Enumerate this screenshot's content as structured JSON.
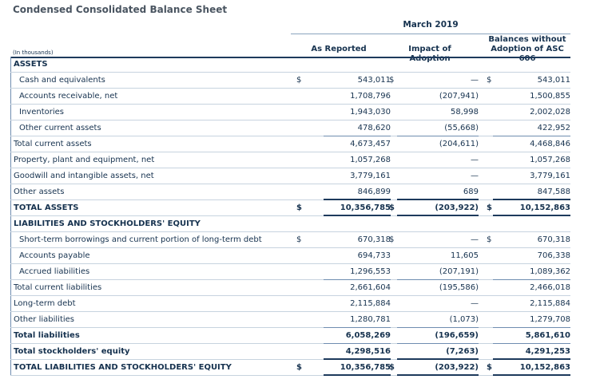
{
  "title": "Condensed Consolidated Balance Sheet",
  "period": "March 2019",
  "units": "(In thousands)",
  "columns": [
    "As Reported",
    "Impact of Adoption",
    "Balances without Adoption of ASC 606"
  ],
  "dollar_sign": "$",
  "rows": [
    {
      "label": "ASSETS",
      "type": "heading",
      "v": [
        "",
        "",
        ""
      ]
    },
    {
      "label": "Cash and equivalents",
      "indent": true,
      "dollar": true,
      "v": [
        "543,011",
        "—",
        "543,011"
      ]
    },
    {
      "label": "Accounts receivable, net",
      "indent": true,
      "v": [
        "1,708,796",
        "(207,941)",
        "1,500,855"
      ]
    },
    {
      "label": "Inventories",
      "indent": true,
      "v": [
        "1,943,030",
        "58,998",
        "2,002,028"
      ]
    },
    {
      "label": "Other current assets",
      "indent": true,
      "v": [
        "478,620",
        "(55,668)",
        "422,952"
      ]
    },
    {
      "label": "Total current assets",
      "v": [
        "4,673,457",
        "(204,611)",
        "4,468,846"
      ]
    },
    {
      "label": "Property, plant and equipment, net",
      "v": [
        "1,057,268",
        "—",
        "1,057,268"
      ]
    },
    {
      "label": "Goodwill and intangible assets, net",
      "v": [
        "3,779,161",
        "—",
        "3,779,161"
      ]
    },
    {
      "label": "Other assets",
      "v": [
        "846,899",
        "689",
        "847,588"
      ]
    },
    {
      "label": "TOTAL ASSETS",
      "type": "bold",
      "dollar": true,
      "v": [
        "10,356,785",
        "(203,922)",
        "10,152,863"
      ]
    },
    {
      "label": "LIABILITIES AND STOCKHOLDERS' EQUITY",
      "type": "heading",
      "v": [
        "",
        "",
        ""
      ]
    },
    {
      "label": "Short-term borrowings and current portion of long-term debt",
      "indent": true,
      "dollar": true,
      "v": [
        "670,318",
        "—",
        "670,318"
      ]
    },
    {
      "label": "Accounts payable",
      "indent": true,
      "v": [
        "694,733",
        "11,605",
        "706,338"
      ]
    },
    {
      "label": "Accrued liabilities",
      "indent": true,
      "v": [
        "1,296,553",
        "(207,191)",
        "1,089,362"
      ]
    },
    {
      "label": "Total current liabilities",
      "v": [
        "2,661,604",
        "(195,586)",
        "2,466,018"
      ]
    },
    {
      "label": "Long-term debt",
      "v": [
        "2,115,884",
        "—",
        "2,115,884"
      ]
    },
    {
      "label": "Other liabilities",
      "v": [
        "1,280,781",
        "(1,073)",
        "1,279,708"
      ]
    },
    {
      "label": "Total liabilities",
      "type": "bold",
      "v": [
        "6,058,269",
        "(196,659)",
        "5,861,610"
      ]
    },
    {
      "label": "Total stockholders' equity",
      "type": "bold",
      "v": [
        "4,298,516",
        "(7,263)",
        "4,291,253"
      ]
    },
    {
      "label": "TOTAL LIABILITIES AND STOCKHOLDERS' EQUITY",
      "type": "bold",
      "dollar": true,
      "v": [
        "10,356,785",
        "(203,922)",
        "10,152,863"
      ]
    }
  ]
}
